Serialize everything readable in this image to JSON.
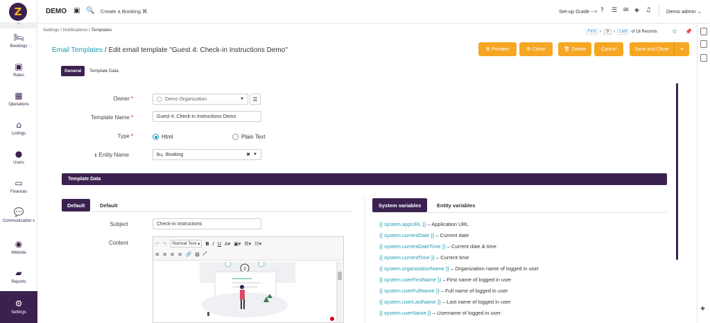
{
  "brand": "DEMO",
  "topbar": {
    "create_booking": "Create a Booking ⌘",
    "setup_guide": "Set-up Guide -->",
    "user": "Demo admin"
  },
  "sidebar": {
    "items": [
      {
        "label": "Bookings",
        "icon": "bed-icon"
      },
      {
        "label": "Rates",
        "icon": "money-icon"
      },
      {
        "label": "Operations",
        "icon": "grid-icon"
      },
      {
        "label": "Listings",
        "icon": "home-icon"
      },
      {
        "label": "Users",
        "icon": "user-icon"
      },
      {
        "label": "Finances",
        "icon": "card-icon"
      },
      {
        "label": "Communication s",
        "icon": "chat-icon"
      },
      {
        "label": "Website",
        "icon": "globe-icon"
      },
      {
        "label": "Reports",
        "icon": "folder-icon"
      },
      {
        "label": "Settings",
        "icon": "gear-icon"
      }
    ]
  },
  "breadcrumb": {
    "a": "Settings",
    "b": "Notifications",
    "c": "Templates"
  },
  "pager": {
    "first": "First",
    "page": "9",
    "last": "Last",
    "records": "of 18 Records"
  },
  "title": {
    "link": "Email Templates",
    "rest": " / Edit email template \"Guest 4: Check-in Instructions Demo\""
  },
  "buttons": {
    "preview": "Preview",
    "clone": "Clone",
    "delete": "Delete",
    "cancel": "Cancel",
    "save_close": "Save and Close"
  },
  "tabs": {
    "general": "General",
    "template_data": "Template Data"
  },
  "form": {
    "owner_label": "Owner",
    "owner_value": "Demo Organization",
    "template_name_label": "Template Name",
    "template_name_value": "Guest 4: Check-in Instructions Demo",
    "type_label": "Type",
    "type_html": "Html",
    "type_plain": "Plain Text",
    "entity_label": "Entity Name",
    "entity_value": "Booking"
  },
  "section_title": "Template Data",
  "content_tabs": {
    "default_active": "Default",
    "default_plain": "Default"
  },
  "subject_label": "Subject",
  "subject_value": "Check-in Instructions",
  "content_label": "Content",
  "editor": {
    "format": "Normal Text"
  },
  "var_tabs": {
    "system": "System variables",
    "entity": "Entity variables"
  },
  "variables": [
    {
      "code": "{{ system.appURL }}",
      "desc": " – Application URL"
    },
    {
      "code": "{{ system.currentDate }}",
      "desc": " – Current date"
    },
    {
      "code": "{{ system.currentDateTime }}",
      "desc": " – Current date & time"
    },
    {
      "code": "{{ system.currentTime }}",
      "desc": " – Current time"
    },
    {
      "code": "{{ system.organizationName }}",
      "desc": " – Organization name of logged in user"
    },
    {
      "code": "{{ system.userFirstName }}",
      "desc": " – First name of logged in user"
    },
    {
      "code": "{{ system.userFullName }}",
      "desc": " – Full name of logged in user"
    },
    {
      "code": "{{ system.userLastName }}",
      "desc": " – Last name of logged in user"
    },
    {
      "code": "{{ system.userName }}",
      "desc": " – Username of logged in user"
    }
  ],
  "colors": {
    "primary": "#3b2150",
    "accent": "#f5a623",
    "link": "#1b9bb5"
  }
}
